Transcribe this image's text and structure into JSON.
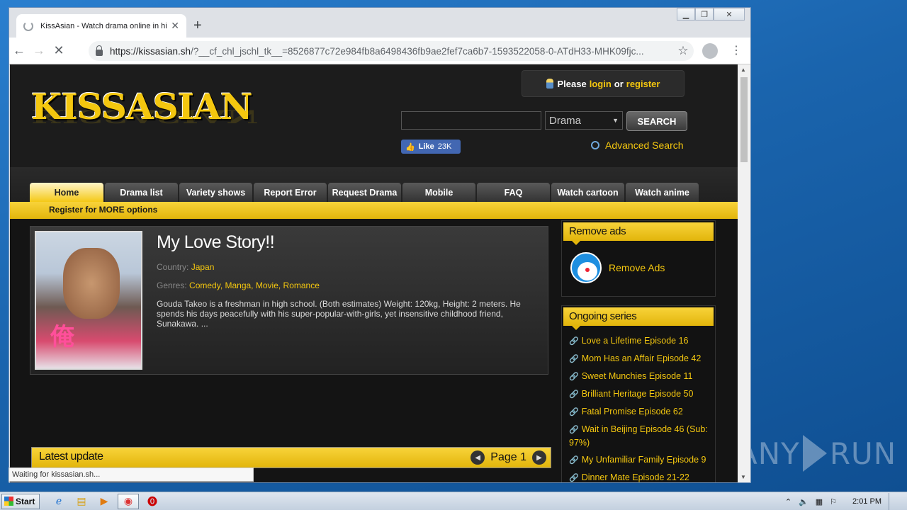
{
  "browser": {
    "tab_title": "KissAsian - Watch drama online in high quality",
    "new_tab": "+",
    "url_host": "https://kissasian.sh",
    "url_rest": "/?__cf_chl_jschl_tk__=8526877c72e984fb8a6498436fb9ae2fef7ca6b7-1593522058-0-ATdH33-MHK09fjc...",
    "status": "Waiting for kissasian.sh..."
  },
  "site": {
    "logo": "KISSASIAN",
    "login": {
      "prefix": "Please",
      "login": "login",
      "or": "or",
      "register": "register"
    },
    "search": {
      "select_value": "Drama",
      "button": "SEARCH",
      "advanced": "Advanced Search"
    },
    "fb": {
      "like": "Like",
      "count": "23K"
    },
    "nav": [
      "Home",
      "Drama list",
      "Variety shows",
      "Report Error",
      "Request Drama",
      "Mobile",
      "FAQ",
      "Watch cartoon",
      "Watch anime"
    ],
    "subnav": "Register for MORE options"
  },
  "featured": {
    "title": "My Love Story!!",
    "country_label": "Country:",
    "country": "Japan",
    "genres_label": "Genres:",
    "genres": "Comedy, Manga, Movie, Romance",
    "summary": "Gouda Takeo is a freshman in high school. (Both estimates) Weight: 120kg, Height: 2 meters. He spends his days peacefully with his super-popular-with-girls, yet insensitive childhood friend, Sunakawa. ...",
    "poster_text": "俺"
  },
  "latest": {
    "label": "Latest update",
    "page": "Page 1"
  },
  "sidebar": {
    "remove_ads_title": "Remove ads",
    "remove_ads_link": "Remove Ads",
    "ongoing_title": "Ongoing series",
    "ongoing": [
      "Love a Lifetime Episode 16",
      "Mom Has an Affair Episode 42",
      "Sweet Munchies Episode 11",
      "Brilliant Heritage Episode 50",
      "Fatal Promise Episode 62",
      "Wait in Beijing Episode 46 (Sub: 97%)",
      "My Unfamiliar Family Episode 9",
      "Dinner Mate Episode 21-22"
    ]
  },
  "taskbar": {
    "start": "Start",
    "time": "2:01 PM"
  },
  "watermark": {
    "left": "ANY",
    "right": "RUN"
  }
}
